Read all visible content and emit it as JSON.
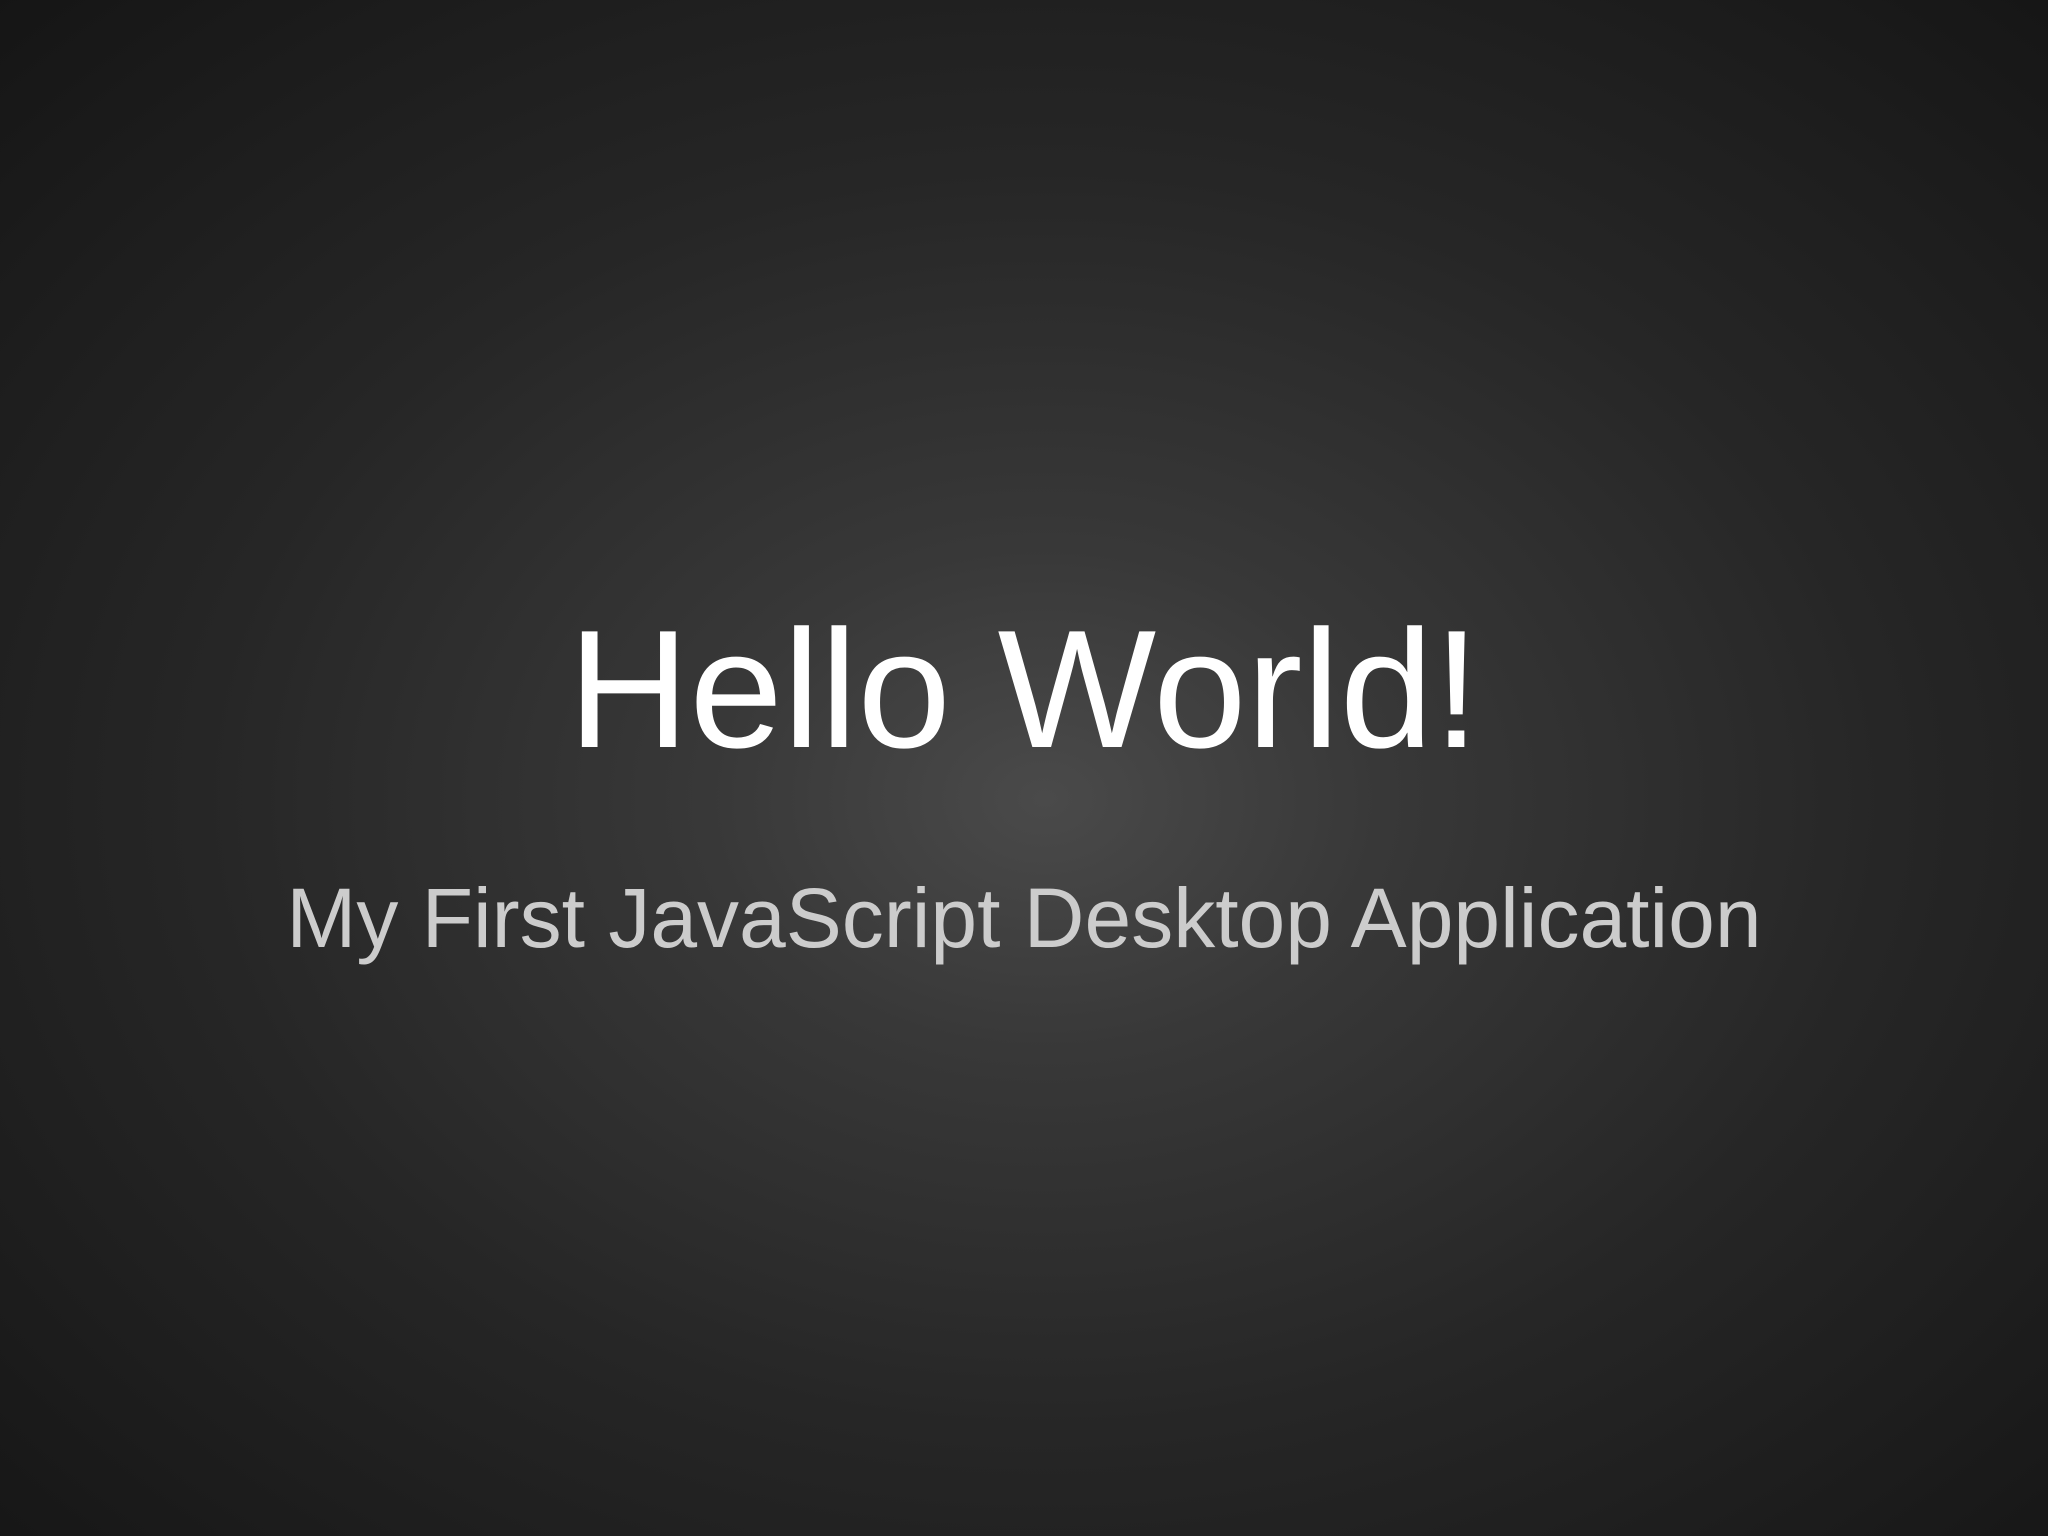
{
  "slide": {
    "title": "Hello World!",
    "subtitle": "My First JavaScript Desktop Application"
  },
  "colors": {
    "background_center": "#4a4a4a",
    "background_edge": "#141414",
    "title_text": "#ffffff",
    "subtitle_text": "#cccccc"
  }
}
